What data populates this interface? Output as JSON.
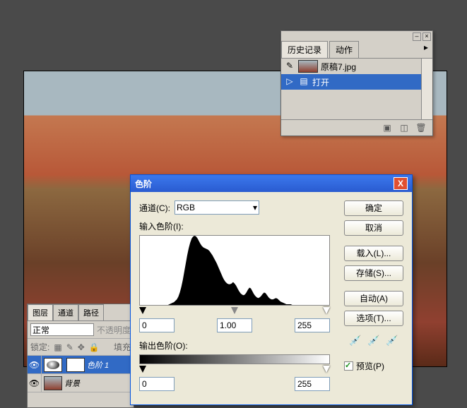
{
  "history": {
    "tabs": [
      "历史记录",
      "动作"
    ],
    "file": "原稿7.jpg",
    "action": "打开"
  },
  "layers": {
    "tabs": [
      "图层",
      "通道",
      "路径"
    ],
    "blend_mode": "正常",
    "opacity_label": "不透明度",
    "lock_label": "锁定:",
    "fill_label": "填充",
    "layer_adj": "色阶 1",
    "layer_bg": "背景"
  },
  "levels": {
    "title": "色阶",
    "channel_label": "通道(C):",
    "channel_value": "RGB",
    "input_label": "输入色阶(I):",
    "output_label": "输出色阶(O):",
    "in_black": "0",
    "in_gamma": "1.00",
    "in_white": "255",
    "out_black": "0",
    "out_white": "255",
    "btn_ok": "确定",
    "btn_cancel": "取消",
    "btn_load": "载入(L)...",
    "btn_save": "存储(S)...",
    "btn_auto": "自动(A)",
    "btn_options": "选项(T)...",
    "preview": "预览(P)"
  },
  "chart_data": {
    "type": "area",
    "title": "",
    "xlabel": "",
    "ylabel": "",
    "x_range": [
      0,
      255
    ],
    "values": [
      0,
      0,
      0,
      0,
      0,
      0,
      0,
      0,
      0,
      0,
      0,
      0,
      0,
      0,
      0,
      0,
      0,
      0,
      0,
      0,
      1,
      2,
      3,
      4,
      6,
      8,
      12,
      18,
      26,
      36,
      48,
      60,
      72,
      82,
      90,
      96,
      99,
      100,
      99,
      96,
      92,
      88,
      85,
      83,
      82,
      81,
      80,
      78,
      75,
      72,
      68,
      64,
      60,
      55,
      50,
      45,
      40,
      36,
      33,
      31,
      30,
      30,
      31,
      33,
      31,
      28,
      24,
      20,
      17,
      15,
      14,
      15,
      18,
      22,
      25,
      24,
      20,
      16,
      13,
      11,
      10,
      11,
      13,
      16,
      18,
      17,
      14,
      11,
      9,
      8,
      8,
      9,
      10,
      9,
      7,
      5,
      4,
      3,
      2,
      1,
      1,
      1,
      1,
      0,
      0,
      0,
      0,
      0,
      0,
      0,
      0,
      0,
      0,
      0,
      0,
      0,
      0,
      0,
      0,
      0,
      0,
      0,
      0,
      0,
      0,
      0,
      0,
      0,
      0
    ]
  }
}
